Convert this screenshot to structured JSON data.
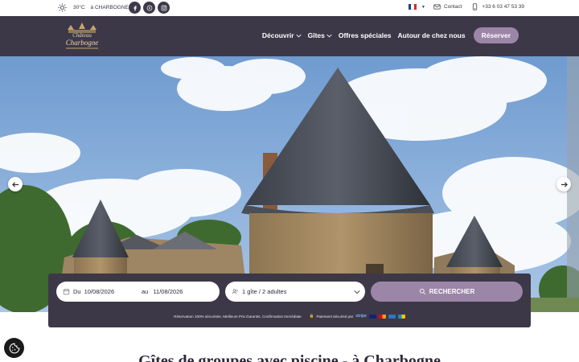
{
  "topbar": {
    "temperature": "30°C",
    "location": "à CHARBOGNE",
    "contact_label": "Contact",
    "phone": "+33 6 03 47 53 39",
    "icons": [
      "sun-icon",
      "facebook-icon",
      "youtube-icon",
      "instagram-icon",
      "mail-icon",
      "phone-icon"
    ]
  },
  "header": {
    "logo_line1": "Château",
    "logo_line2": "Charbogne",
    "nav": [
      "Découvrir",
      "Gîtes",
      "Offres spéciales",
      "Autour de chez nous"
    ],
    "reserve_label": "Réserver"
  },
  "search": {
    "from_label": "Du",
    "from_date": "10/08/2026",
    "to_label": "au",
    "to_date": "11/08/2026",
    "guests": "1 gîte / 2 adultes",
    "button_label": "RECHERCHER",
    "reassurance": "Réservation 100% sécurisée, Meilleurs Prix Garantis, Confirmation Immédiate",
    "payment_label": "Paiement sécurisé par",
    "payment_brand": "stripe"
  },
  "main": {
    "headline": "Gîtes de groupes avec piscine - à Charbogne"
  },
  "colors": {
    "brand_dark": "#3d3847",
    "accent_lilac": "#9b86a8",
    "white": "#ffffff"
  }
}
